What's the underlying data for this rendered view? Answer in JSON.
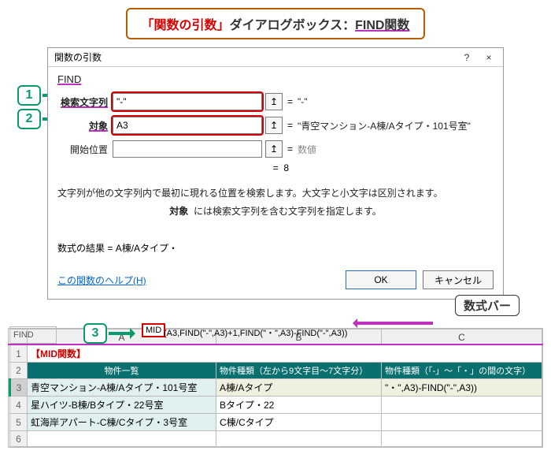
{
  "title": {
    "part1": "「関数の引数」",
    "part2": "ダイアログボックス：",
    "part3": "FIND関数"
  },
  "badges": {
    "one": "1",
    "two": "2",
    "three": "3"
  },
  "dialog": {
    "title": "関数の引数",
    "help_icon": "?",
    "close_icon": "×",
    "func_name": "FIND",
    "args": {
      "find_text": {
        "label": "検索文字列",
        "value": "\"-\"",
        "eq": "=",
        "result": "\"-\""
      },
      "within": {
        "label": "対象",
        "value": "A3",
        "eq": "=",
        "result": "\"青空マンション-A棟/Aタイプ・101号室\""
      },
      "start": {
        "label": "開始位置",
        "value": "",
        "eq": "=",
        "result": "数値"
      }
    },
    "ref_btn": "↥",
    "overall": {
      "eq": "=",
      "value": "8"
    },
    "desc1": "文字列が他の文字列内で最初に現れる位置を検索します。大文字と小文字は区別されます。",
    "desc2_label": "対象",
    "desc2_text": "には検索文字列を含む文字列を指定します。",
    "formula_result_label": "数式の結果 = ",
    "formula_result_value": "A棟/Aタイプ・",
    "help_link": "この関数のヘルプ(H)",
    "ok": "OK",
    "cancel": "キャンセル"
  },
  "formulabar": {
    "namebox": "FIND",
    "highlight": "MID",
    "rest": "(A3,FIND(\"-\",A3)+1,FIND(\"・\",A3)-FIND(\"-\",A3))",
    "label": "数式バー"
  },
  "sheet": {
    "cols": {
      "a": "A",
      "b": "B",
      "c": "C"
    },
    "r1": {
      "n": "1",
      "a": "【MID関数】"
    },
    "r2": {
      "n": "2",
      "a": "物件一覧",
      "b": "物件種類（左から9文字目～7文字分）",
      "c": "物件種類（「-」～「・」の間の文字）"
    },
    "r3": {
      "n": "3",
      "a": "青空マンション-A棟/Aタイプ・101号室",
      "b": "A棟/Aタイプ",
      "c": "\"・\",A3)-FIND(\"-\",A3))"
    },
    "r4": {
      "n": "4",
      "a": "星ハイツ-B棟/Bタイプ・22号室",
      "b": "Bタイプ・22"
    },
    "r5": {
      "n": "5",
      "a": "虹海岸アパート-C棟/Cタイプ・3号室",
      "b": "C棟/Cタイプ"
    },
    "r6": {
      "n": "6"
    }
  }
}
